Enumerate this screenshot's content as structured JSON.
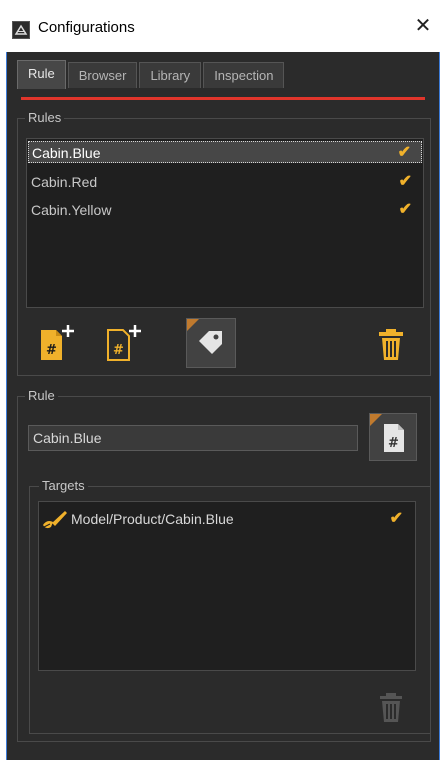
{
  "window": {
    "title": "Configurations",
    "close_glyph": "✕"
  },
  "tabs": [
    {
      "label": "Rule",
      "active": true
    },
    {
      "label": "Browser",
      "active": false
    },
    {
      "label": "Library",
      "active": false
    },
    {
      "label": "Inspection",
      "active": false
    }
  ],
  "rules_group": {
    "label": "Rules",
    "items": [
      {
        "label": "Cabin.Blue",
        "checked": true,
        "selected": true
      },
      {
        "label": "Cabin.Red",
        "checked": true,
        "selected": false
      },
      {
        "label": "Cabin.Yellow",
        "checked": true,
        "selected": false
      }
    ],
    "toolbar": [
      {
        "name": "add-rule-icon"
      },
      {
        "name": "add-rule-outline-icon"
      },
      {
        "name": "tag-icon"
      },
      {
        "name": "trash-icon"
      }
    ]
  },
  "rule_group": {
    "label": "Rule",
    "value": "Cabin.Blue",
    "action_icon": "rule-document-icon"
  },
  "targets_group": {
    "label": "Targets",
    "items": [
      {
        "label": "Model/Product/Cabin.Blue",
        "checked": true,
        "icon": "brush-icon"
      }
    ],
    "delete_icon": "trash-disabled-icon"
  },
  "check_glyph": "✔",
  "colors": {
    "accent": "#f0b12b",
    "tab_indicator": "#e0352b",
    "background": "#2b2b2b"
  }
}
